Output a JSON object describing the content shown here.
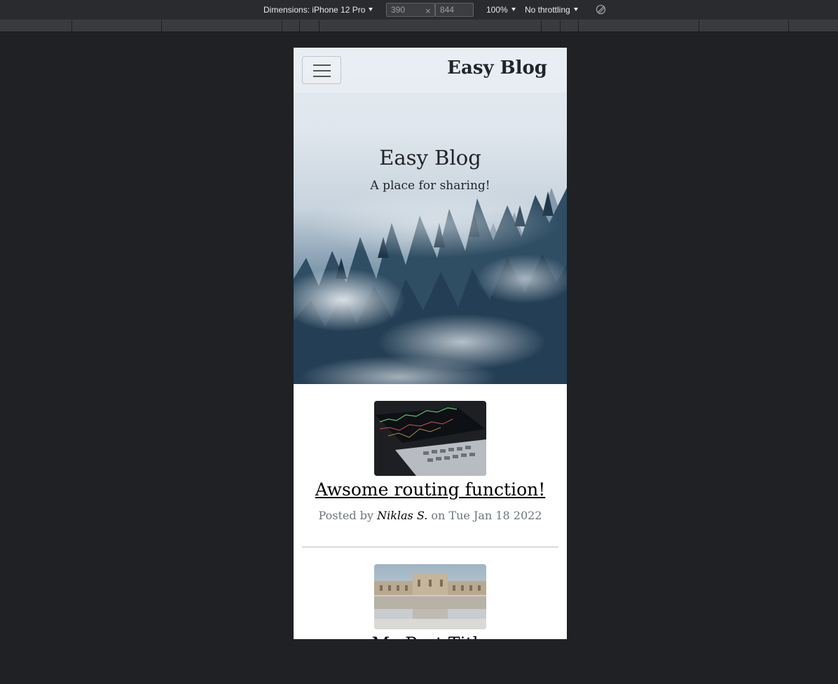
{
  "devtools": {
    "dimensions_label": "Dimensions: iPhone 12 Pro",
    "width_value": "390",
    "height_value": "844",
    "times_symbol": "×",
    "zoom": "100%",
    "throttling": "No throttling"
  },
  "site": {
    "brand": "Easy Blog",
    "hero_title": "Easy Blog",
    "hero_subtitle": "A place for sharing!"
  },
  "posts": [
    {
      "title": "Awsome routing function!",
      "meta_prefix": "Posted by",
      "author": "Niklas S.",
      "meta_suffix": "on Tue Jan 18 2022"
    },
    {
      "title": "My Post Title"
    }
  ]
}
